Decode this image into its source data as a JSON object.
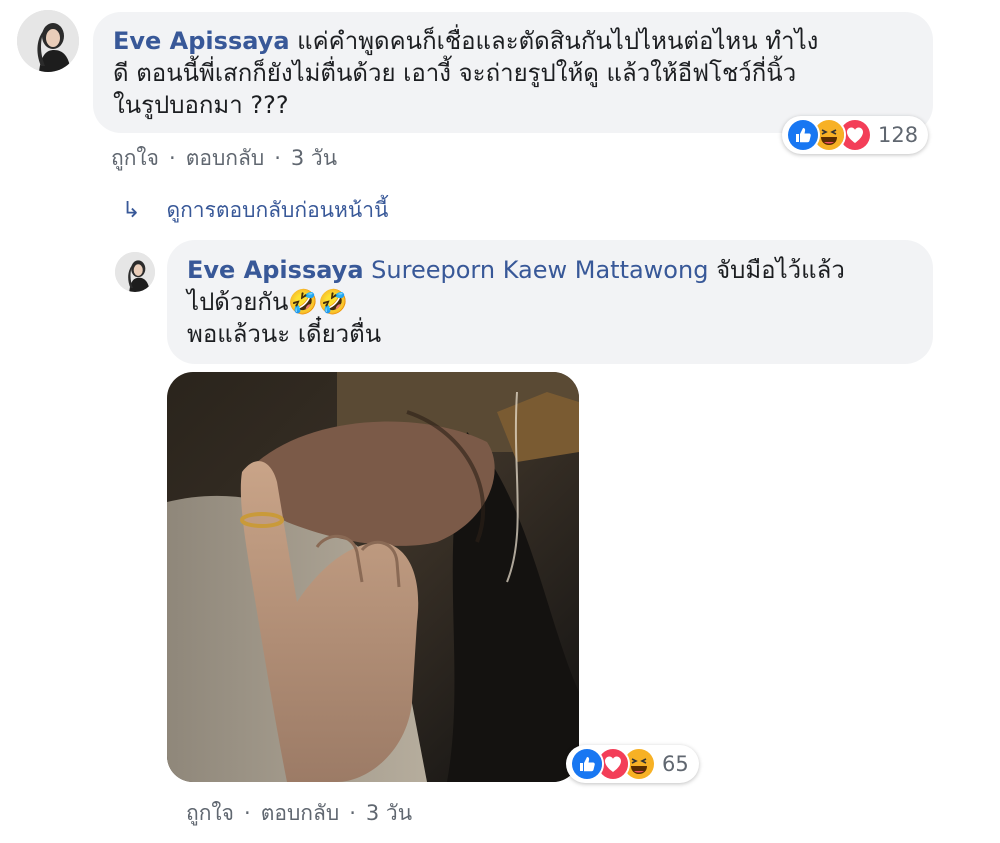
{
  "comment": {
    "author": "Eve Apissaya",
    "line1": " แค่คำพูดคนก็เชื่อและตัดสินกันไปไหนต่อไหน ทำไง",
    "line2": "ดี ตอนนี้พี่เสกก็ยังไม่ตื่นด้วย เอางี้ จะถ่ายรูปให้ดู แล้วให้อีฟโชว์กี่นิ้ว",
    "line3": "ในรูปบอกมา ???",
    "like_label": "ถูกใจ",
    "reply_label": "ตอบกลับ",
    "time": "3 วัน",
    "separator": "·",
    "reaction_count": "128",
    "reaction_icons": [
      "like-icon",
      "haha-icon",
      "love-icon"
    ]
  },
  "previous_replies": {
    "label": "ดูการตอบกลับก่อนหน้านี้"
  },
  "reply": {
    "author": "Eve Apissaya",
    "mention": "Sureeporn Kaew Mattawong",
    "line1": " จับมือไว้แล้ว",
    "line2": "ไปด้วยกัน🤣🤣",
    "line3": "พอแล้วนะ เดี๋ยวตื่น",
    "like_label": "ถูกใจ",
    "reply_label": "ตอบกลับ",
    "time": "3 วัน",
    "separator": "·",
    "reaction_count": "65",
    "reaction_icons": [
      "like-icon",
      "love-icon",
      "haha-icon"
    ]
  },
  "colors": {
    "link": "#385898",
    "bubble": "#f2f3f5",
    "meta": "#606770",
    "like": "#1877f2",
    "love": "#f33e58",
    "haha": "#f7b125"
  }
}
